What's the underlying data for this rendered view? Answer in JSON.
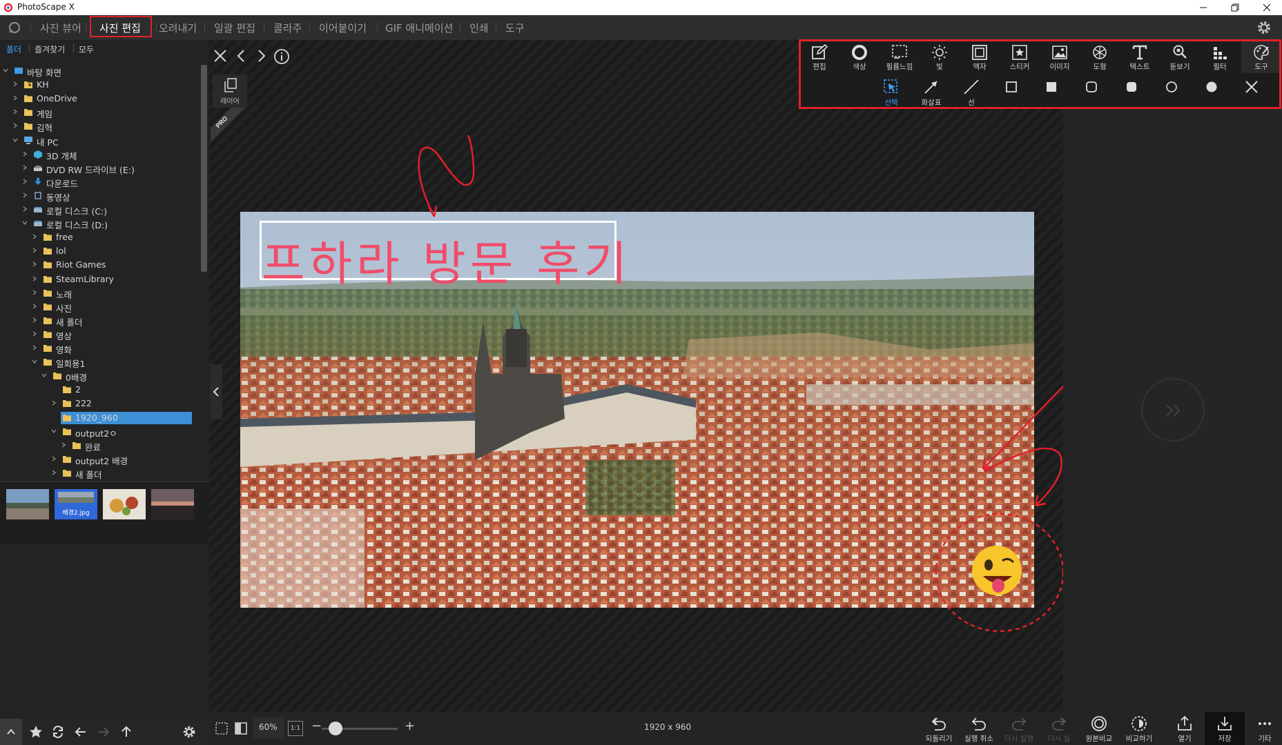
{
  "window": {
    "title": "PhotoScape X"
  },
  "menu": {
    "tabs": [
      {
        "label": "사진 뷰어"
      },
      {
        "label": "사진 편집"
      },
      {
        "label": "오려내기"
      },
      {
        "label": "일괄 편집"
      },
      {
        "label": "콜라주"
      },
      {
        "label": "이어붙이기"
      },
      {
        "label": "GIF 애니메이션"
      },
      {
        "label": "인쇄"
      },
      {
        "label": "도구"
      }
    ],
    "active_index": 1
  },
  "left_tabs": [
    {
      "label": "폴더"
    },
    {
      "label": "즐겨찾기"
    },
    {
      "label": "모두"
    }
  ],
  "tree": [
    {
      "label": "바탕 화면",
      "icon": "desktop",
      "depth": 0,
      "expanded": true
    },
    {
      "label": "KH",
      "icon": "user-folder",
      "depth": 1,
      "expanded": false
    },
    {
      "label": "OneDrive",
      "icon": "folder",
      "depth": 1,
      "expanded": false
    },
    {
      "label": "게임",
      "icon": "folder",
      "depth": 1,
      "expanded": false
    },
    {
      "label": "김혁",
      "icon": "folder",
      "depth": 1,
      "expanded": false
    },
    {
      "label": "내 PC",
      "icon": "pc",
      "depth": 1,
      "expanded": true
    },
    {
      "label": "3D 개체",
      "icon": "cube",
      "depth": 2,
      "expanded": false
    },
    {
      "label": "DVD RW 드라이브 (E:)",
      "icon": "dvd",
      "depth": 2,
      "expanded": false
    },
    {
      "label": "다운로드",
      "icon": "download",
      "depth": 2,
      "expanded": false
    },
    {
      "label": "동영상",
      "icon": "video",
      "depth": 2,
      "expanded": false
    },
    {
      "label": "로컬 디스크 (C:)",
      "icon": "disk",
      "depth": 2,
      "expanded": false
    },
    {
      "label": "로컬 디스크 (D:)",
      "icon": "disk",
      "depth": 2,
      "expanded": true
    },
    {
      "label": "free",
      "icon": "folder",
      "depth": 3,
      "expanded": false
    },
    {
      "label": "lol",
      "icon": "folder",
      "depth": 3,
      "expanded": false
    },
    {
      "label": "Riot Games",
      "icon": "folder",
      "depth": 3,
      "expanded": false
    },
    {
      "label": "SteamLibrary",
      "icon": "folder",
      "depth": 3,
      "expanded": false
    },
    {
      "label": "노래",
      "icon": "folder",
      "depth": 3,
      "expanded": false
    },
    {
      "label": "사진",
      "icon": "folder",
      "depth": 3,
      "expanded": false
    },
    {
      "label": "새 폴더",
      "icon": "folder",
      "depth": 3,
      "expanded": false
    },
    {
      "label": "영상",
      "icon": "folder",
      "depth": 3,
      "expanded": false
    },
    {
      "label": "영화",
      "icon": "folder",
      "depth": 3,
      "expanded": false
    },
    {
      "label": "일회용1",
      "icon": "folder",
      "depth": 3,
      "expanded": true
    },
    {
      "label": "0배경",
      "icon": "folder",
      "depth": 4,
      "expanded": true
    },
    {
      "label": "2",
      "icon": "folder",
      "depth": 5,
      "expanded": null
    },
    {
      "label": "222",
      "icon": "folder",
      "depth": 5,
      "expanded": false
    },
    {
      "label": "1920_960",
      "icon": "folder",
      "depth": 5,
      "expanded": null,
      "selected": true
    },
    {
      "label": "output2ㅇ",
      "icon": "folder",
      "depth": 5,
      "expanded": true
    },
    {
      "label": "완료",
      "icon": "folder",
      "depth": 6,
      "expanded": false
    },
    {
      "label": "output2 배경",
      "icon": "folder",
      "depth": 5,
      "expanded": false
    },
    {
      "label": "새 폴더",
      "icon": "folder",
      "depth": 5,
      "expanded": false
    }
  ],
  "thumbnails": [
    {
      "label": "",
      "selected": false
    },
    {
      "label": "배경2.jpg",
      "selected": true
    },
    {
      "label": "",
      "selected": false
    },
    {
      "label": "",
      "selected": false
    }
  ],
  "layer_button": {
    "label": "레이어"
  },
  "pro_badge": {
    "label": "PRO"
  },
  "photo": {
    "title_text": "프하라 방문 후기"
  },
  "toolbar": {
    "tools": [
      {
        "label": "편집",
        "icon": "edit"
      },
      {
        "label": "색상",
        "icon": "color"
      },
      {
        "label": "필름느낌",
        "icon": "film"
      },
      {
        "label": "빛",
        "icon": "light"
      },
      {
        "label": "액자",
        "icon": "frame"
      },
      {
        "label": "스티커",
        "icon": "sticker"
      },
      {
        "label": "이미지",
        "icon": "image"
      },
      {
        "label": "도형",
        "icon": "shape"
      },
      {
        "label": "텍스트",
        "icon": "text"
      },
      {
        "label": "돋보기",
        "icon": "magnifier"
      },
      {
        "label": "필터",
        "icon": "filter"
      },
      {
        "label": "도구",
        "icon": "tools"
      }
    ],
    "sub_tools": [
      {
        "label": "선택",
        "icon": "select",
        "selected": true
      },
      {
        "label": "화살표",
        "icon": "arrow"
      },
      {
        "label": "선",
        "icon": "line"
      },
      {
        "label": "",
        "icon": "square-outline"
      },
      {
        "label": "",
        "icon": "square-filled"
      },
      {
        "label": "",
        "icon": "rounded-outline"
      },
      {
        "label": "",
        "icon": "rounded-filled"
      },
      {
        "label": "",
        "icon": "circle-outline"
      },
      {
        "label": "",
        "icon": "circle-filled"
      },
      {
        "label": "",
        "icon": "close"
      }
    ]
  },
  "status": {
    "zoom": "60%",
    "zoom_fit": "1:1",
    "zoom_value": 0.18,
    "dimensions": "1920 x 960"
  },
  "actions": [
    {
      "label": "되돌리기",
      "icon": "revert",
      "disabled": false
    },
    {
      "label": "실행 취소",
      "icon": "undo",
      "disabled": false
    },
    {
      "label": "다시 실행",
      "icon": "redo",
      "disabled": true
    },
    {
      "label": "다시 실",
      "icon": "redo-all",
      "disabled": true
    },
    {
      "label": "원본비교",
      "icon": "compare-original",
      "disabled": false
    },
    {
      "label": "비교하기",
      "icon": "compare",
      "disabled": false
    },
    {
      "label": "열기",
      "icon": "open",
      "disabled": false
    },
    {
      "label": "저장",
      "icon": "save",
      "disabled": false
    },
    {
      "label": "기타",
      "icon": "more",
      "disabled": false
    }
  ],
  "colors": {
    "accent_red": "#e2202a",
    "selection_blue": "#3d8fd6",
    "title_pink": "#f04d6b"
  }
}
